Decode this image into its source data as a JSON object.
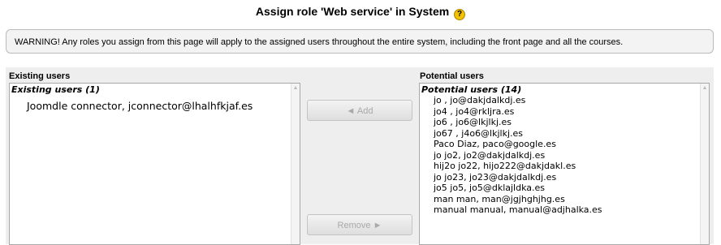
{
  "page": {
    "title": "Assign role 'Web service' in System",
    "help_icon_glyph": "?"
  },
  "warning": {
    "text": "WARNING! Any roles you assign from this page will apply to the assigned users throughout the entire system, including the front page and all the courses."
  },
  "existing": {
    "header": "Existing users",
    "group_label": "Existing users (1)",
    "options": [
      "Joomdle connector, jconnector@lhalhfkjaf.es"
    ]
  },
  "buttons": {
    "add_label": "◄ Add",
    "remove_label": "Remove ►",
    "enabled": false
  },
  "potential": {
    "header": "Potential users",
    "group_label": "Potential users (14)",
    "options": [
      "jo , jo@dakjdalkdj.es",
      "jo4 , jo4@rkljra.es",
      "jo6 , jo6@lkjlkj.es",
      "jo67 , j4o6@lkjlkj.es",
      "Paco Diaz, paco@google.es",
      "jo jo2, jo2@dakjdalkdj.es",
      "hij2o jo22, hijo222@dakjdakl.es",
      "jo jo23, jo23@dakjdalkdj.es",
      "jo5 jo5, jo5@dklajldka.es",
      "man man, man@jgjhghjhg.es",
      "manual manual, manual@adjhalka.es"
    ]
  }
}
